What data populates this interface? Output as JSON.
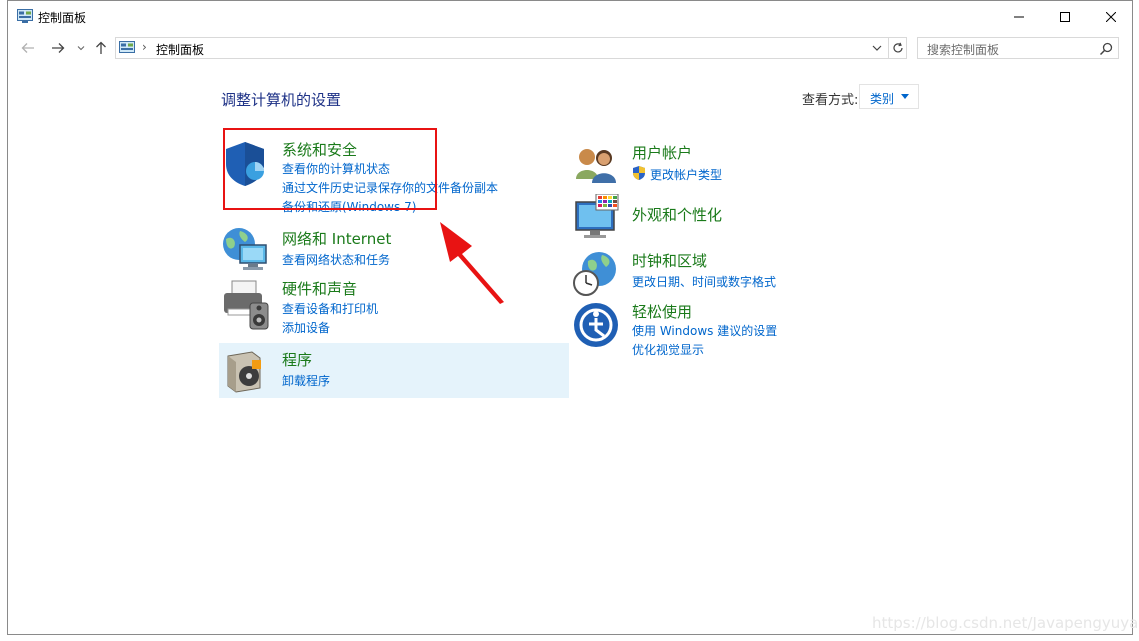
{
  "window": {
    "title": "控制面板",
    "buttons": {
      "minimize": "minimize-icon",
      "maximize": "maximize-icon",
      "close": "close-icon"
    }
  },
  "address": {
    "breadcrumb": "控制面板",
    "search_placeholder": "搜索控制面板"
  },
  "content": {
    "heading": "调整计算机的设置",
    "view_by_label": "查看方式:",
    "view_by_value": "类别"
  },
  "categories": {
    "system_security": {
      "title": "系统和安全",
      "links": [
        "查看你的计算机状态",
        "通过文件历史记录保存你的文件备份副本",
        "备份和还原(Windows 7)"
      ]
    },
    "network": {
      "title": "网络和 Internet",
      "links": [
        "查看网络状态和任务"
      ]
    },
    "hardware": {
      "title": "硬件和声音",
      "links": [
        "查看设备和打印机",
        "添加设备"
      ]
    },
    "programs": {
      "title": "程序",
      "links": [
        "卸载程序"
      ]
    },
    "user_accounts": {
      "title": "用户帐户",
      "links": [
        "更改帐户类型"
      ]
    },
    "appearance": {
      "title": "外观和个性化",
      "links": []
    },
    "clock_region": {
      "title": "时钟和区域",
      "links": [
        "更改日期、时间或数字格式"
      ]
    },
    "ease": {
      "title": "轻松使用",
      "links": [
        "使用 Windows 建议的设置",
        "优化视觉显示"
      ]
    }
  },
  "watermark": "https://blog.csdn.net/Javapengyuyan",
  "colors": {
    "link": "#0066cc",
    "category_title": "#1a7a1a",
    "heading": "#1e3287",
    "highlight": "#e5f3fb",
    "annotation": "#e81313"
  }
}
